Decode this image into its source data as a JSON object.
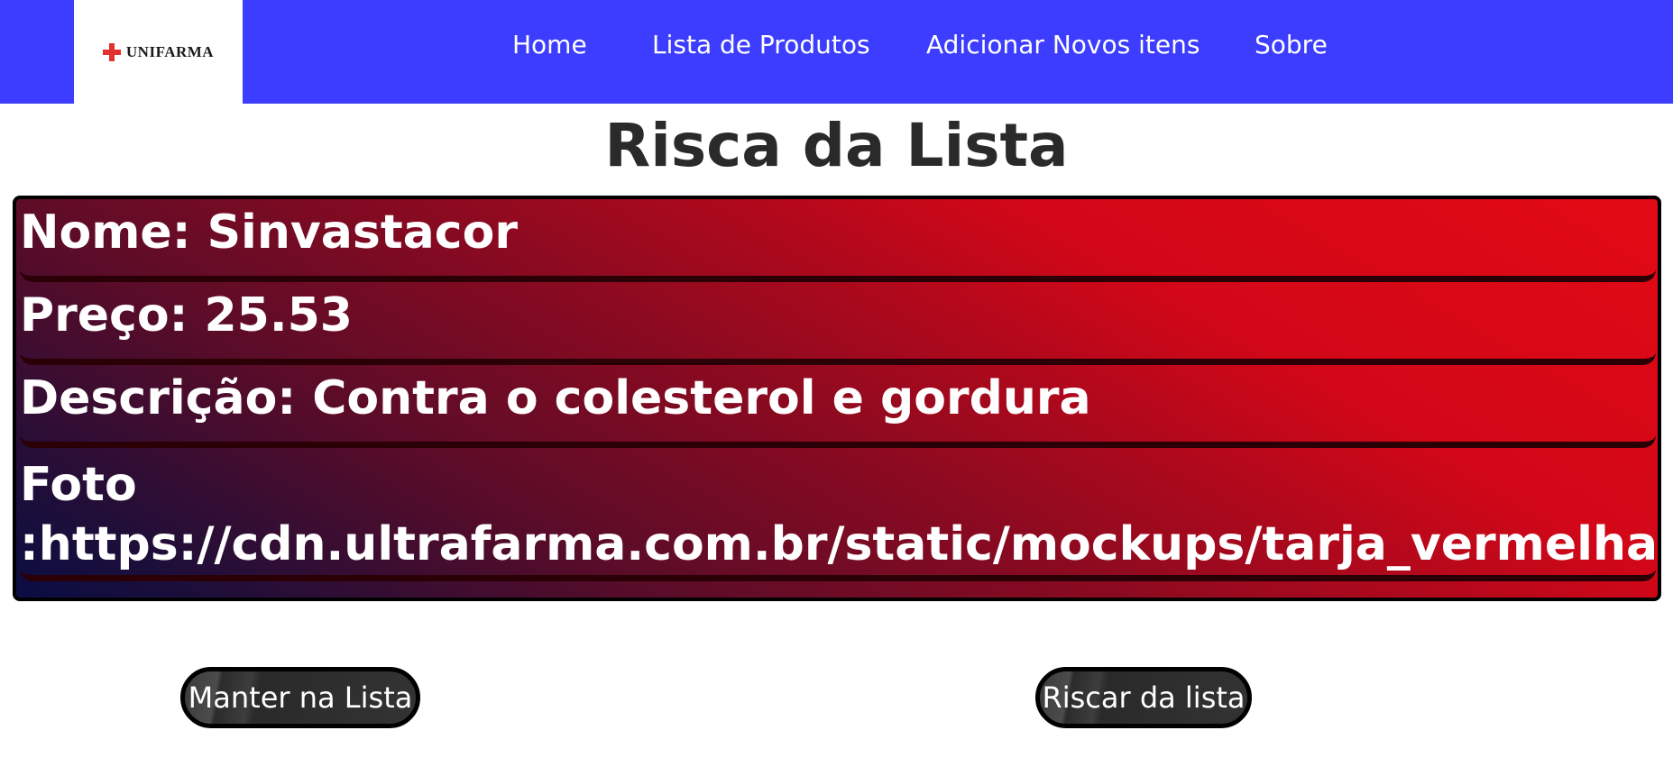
{
  "brand": {
    "logo_text": "UNIFARMA"
  },
  "nav": {
    "items": [
      {
        "label": "Home"
      },
      {
        "label": "Lista de Produtos"
      },
      {
        "label": "Adicionar Novos itens"
      },
      {
        "label": "Sobre"
      }
    ]
  },
  "page": {
    "title": "Risca da Lista"
  },
  "product": {
    "name_label": "Nome: ",
    "name": "Sinvastacor",
    "price_label": "Preço: ",
    "price": "25.53",
    "description_label": "Descrição: ",
    "description": "Contra o colesterol e gordura",
    "photo_label": "Foto",
    "photo_url": ":https://cdn.ultrafarma.com.br/static/mockups/tarja_vermelha.jpg"
  },
  "actions": {
    "keep_label": "Manter na Lista",
    "remove_label": "Riscar da lista"
  },
  "colors": {
    "navbar": "#3d3dff",
    "card_gradient_top": "#e20a14",
    "card_gradient_bottom": "#0a0d44",
    "button_bg": "#333333"
  }
}
